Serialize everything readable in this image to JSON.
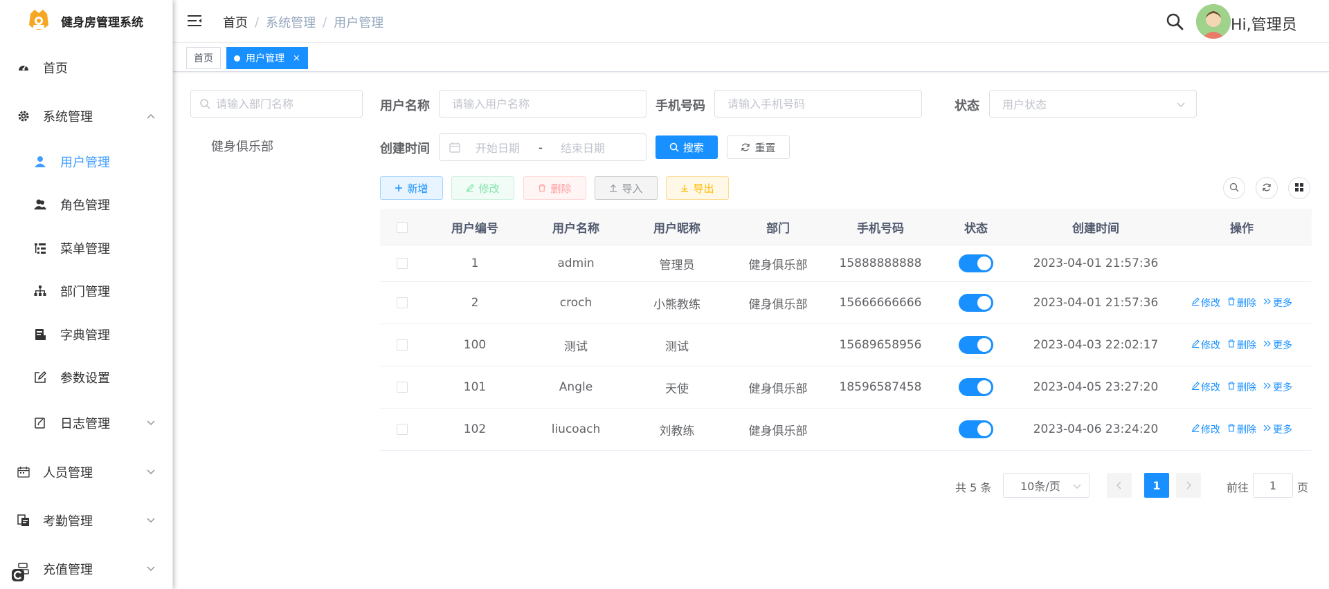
{
  "app": {
    "title": "健身房管理系统"
  },
  "sidebar": {
    "items": [
      {
        "label": "首页"
      },
      {
        "label": "系统管理"
      },
      {
        "label": "用户管理"
      },
      {
        "label": "角色管理"
      },
      {
        "label": "菜单管理"
      },
      {
        "label": "部门管理"
      },
      {
        "label": "字典管理"
      },
      {
        "label": "参数设置"
      },
      {
        "label": "日志管理"
      },
      {
        "label": "人员管理"
      },
      {
        "label": "考勤管理"
      },
      {
        "label": "充值管理"
      }
    ]
  },
  "header": {
    "breadcrumb": [
      "首页",
      "系统管理",
      "用户管理"
    ],
    "greeting": "Hi,管理员"
  },
  "tags": {
    "home": "首页",
    "active": "用户管理",
    "close": "×"
  },
  "tree": {
    "placeholder": "请输入部门名称",
    "nodes": [
      "健身俱乐部"
    ]
  },
  "search": {
    "username_label": "用户名称",
    "username_placeholder": "请输入用户名称",
    "phone_label": "手机号码",
    "phone_placeholder": "请输入手机号码",
    "status_label": "状态",
    "status_placeholder": "用户状态",
    "created_label": "创建时间",
    "start_placeholder": "开始日期",
    "range_sep": "-",
    "end_placeholder": "结束日期",
    "search_btn": "搜索",
    "reset_btn": "重置"
  },
  "toolbar": {
    "add": "新增",
    "edit": "修改",
    "delete": "删除",
    "import": "导入",
    "export": "导出"
  },
  "table": {
    "headers": [
      "用户编号",
      "用户名称",
      "用户昵称",
      "部门",
      "手机号码",
      "状态",
      "创建时间",
      "操作"
    ],
    "rows": [
      {
        "id": "1",
        "username": "admin",
        "nickname": "管理员",
        "dept": "健身俱乐部",
        "phone": "15888888888",
        "status": true,
        "created": "2023-04-01 21:57:36"
      },
      {
        "id": "2",
        "username": "croch",
        "nickname": "小熊教练",
        "dept": "健身俱乐部",
        "phone": "15666666666",
        "status": true,
        "created": "2023-04-01 21:57:36"
      },
      {
        "id": "100",
        "username": "测试",
        "nickname": "测试",
        "dept": "",
        "phone": "15689658956",
        "status": true,
        "created": "2023-04-03 22:02:17"
      },
      {
        "id": "101",
        "username": "Angle",
        "nickname": "天使",
        "dept": "健身俱乐部",
        "phone": "18596587458",
        "status": true,
        "created": "2023-04-05 23:27:20"
      },
      {
        "id": "102",
        "username": "liucoach",
        "nickname": "刘教练",
        "dept": "健身俱乐部",
        "phone": "",
        "status": true,
        "created": "2023-04-06 23:24:20"
      }
    ],
    "op_edit": "修改",
    "op_delete": "删除",
    "op_more": "更多"
  },
  "pagination": {
    "total": "共 5 条",
    "page_size": "10条/页",
    "current": "1",
    "goto_label": "前往",
    "goto_value": "1",
    "page_label": "页"
  },
  "colors": {
    "primary": "#1890ff",
    "active_menu": "#409eff"
  }
}
